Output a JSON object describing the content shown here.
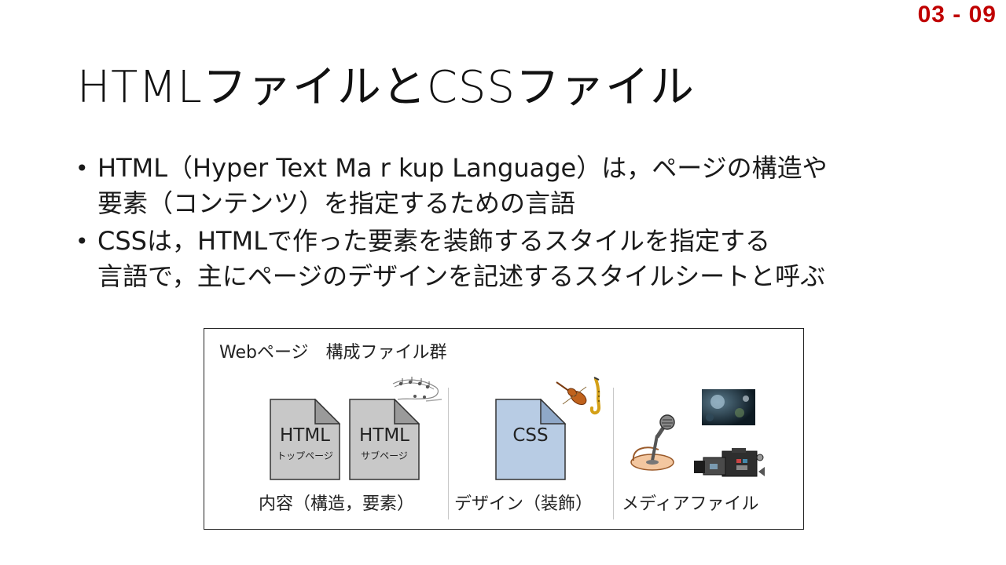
{
  "slide_number": "03 - 09",
  "title": "HTMLファイルとCSSファイル",
  "bullets": [
    {
      "lines": [
        "HTML（Hyper Text Ma r kup Language）は，ページの構造や",
        "要素（コンテンツ）を指定するための言語"
      ]
    },
    {
      "lines": [
        "CSSは，HTMLで作った要素を装飾するスタイルを指定する",
        "言語で，主にページのデザインを記述するスタイルシートと呼ぶ"
      ]
    }
  ],
  "diagram": {
    "caption": "Webページ　構成ファイル群",
    "files": [
      {
        "main": "HTML",
        "sub": "トップページ",
        "color": "#c8c8c8"
      },
      {
        "main": "HTML",
        "sub": "サブページ",
        "color": "#c8c8c8"
      },
      {
        "main": "CSS",
        "sub": "",
        "color": "#b8cce4"
      }
    ],
    "columns": [
      "内容（構造，要素）",
      "デザイン（装飾）",
      "メディアファイル"
    ],
    "art": [
      "music-notes-icon",
      "violin-saxophone-icon",
      "microphone-icon",
      "photo-icon",
      "video-camera-icon"
    ]
  },
  "colors": {
    "accent": "#c00000",
    "html_file": "#c8c8c8",
    "css_file": "#b8cce4"
  }
}
